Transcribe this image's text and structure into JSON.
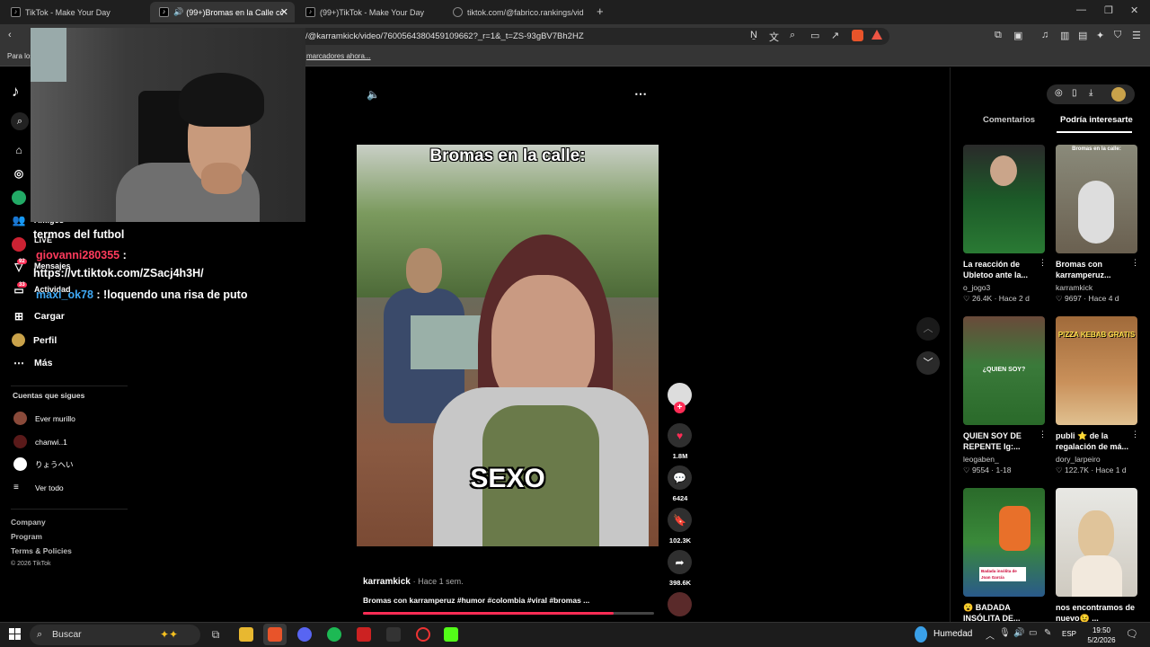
{
  "browser": {
    "tabs": [
      {
        "label": "TikTok - Make Your Day"
      },
      {
        "label": "(99+)Bromas en la Calle con k"
      },
      {
        "label": "(99+)TikTok - Make Your Day"
      },
      {
        "label": "tiktok.com/@fabrico.rankings/video/"
      }
    ],
    "address": "/@karramkick/video/7600564380459109662?_r=1&_t=ZS-93gBV7Bh2HZ",
    "bookmarks_left": "Para los",
    "bookmarks_text": "marcadores ahora..."
  },
  "nav": {
    "friends_label": "Amigos",
    "live_label": "LIVE",
    "messages_label": "Mensajes",
    "messages_badge": "92",
    "activity_label": "Actividad",
    "activity_badge": "33",
    "upload_label": "Cargar",
    "profile_label": "Perfil",
    "more_label": "Más",
    "following_header": "Cuentas que sigues",
    "following": [
      {
        "name": "Ever murillo"
      },
      {
        "name": "chanwi..1"
      },
      {
        "name": "りょうへい"
      }
    ],
    "see_all": "Ver todo",
    "footer": [
      "Company",
      "Program",
      "Terms & Policies",
      "© 2026 TikTok"
    ]
  },
  "chat": [
    {
      "text": "termos del futbol"
    },
    {
      "user": "giovanni280355",
      "text": ":"
    },
    {
      "text": "https://vt.tiktok.com/ZSacj4h3H/"
    },
    {
      "user": "maxi_ok78",
      "text": ": !loquendo una risa de puto"
    }
  ],
  "video": {
    "caption_top": "Bromas en la calle:",
    "caption_center": "SEXO",
    "author": "karramkick",
    "date": "· Hace 1 sem.",
    "description": "Bromas con karramperuz #humor #colombia #viral #bromas ...",
    "likes": "1.8M",
    "comments": "6424",
    "saves": "102.3K",
    "shares": "398.6K",
    "progress": 0.86
  },
  "right": {
    "tabs": [
      {
        "label": "Comentarios"
      },
      {
        "label": "Podría interesarte"
      }
    ],
    "cards": [
      {
        "title": "La reacción de Ubletoo ante la...",
        "author": "o_jogo3",
        "likes": "26.4K",
        "date": "· Hace 2 d",
        "overlay": ""
      },
      {
        "title": "Bromas con karramperuz...",
        "author": "karramkick",
        "likes": "9697",
        "date": "· Hace 4 d",
        "overlay": "Bromas en la calle:"
      },
      {
        "title": "QUIEN SOY DE REPENTE Ig:...",
        "author": "leogaben_",
        "likes": "9554",
        "date": "· 1-18",
        "overlay": "¿QUIEN SOY?"
      },
      {
        "title": "publi ⭐ de la regalación de má...",
        "author": "dory_larpeiro",
        "likes": "122.7K",
        "date": "· Hace 1 d",
        "overlay": "PIZZA KEBAB GRATIS"
      },
      {
        "title": "😮 BADADA INSÓLITA DE...",
        "author": "",
        "likes": "",
        "date": "",
        "overlay": "Badada insólita de Joan García"
      },
      {
        "title": "nos encontramos de nuevo😉 ...",
        "author": "",
        "likes": "",
        "date": "",
        "overlay": ""
      }
    ]
  },
  "taskbar": {
    "search_placeholder": "Buscar",
    "weather": "Humedad",
    "lang": "ESP",
    "time": "19:50",
    "date": "5/2/2026"
  },
  "colors": {
    "accent": "#fe2c55",
    "link": "#3fa9f5",
    "chat_user": "#ff3b5c"
  }
}
